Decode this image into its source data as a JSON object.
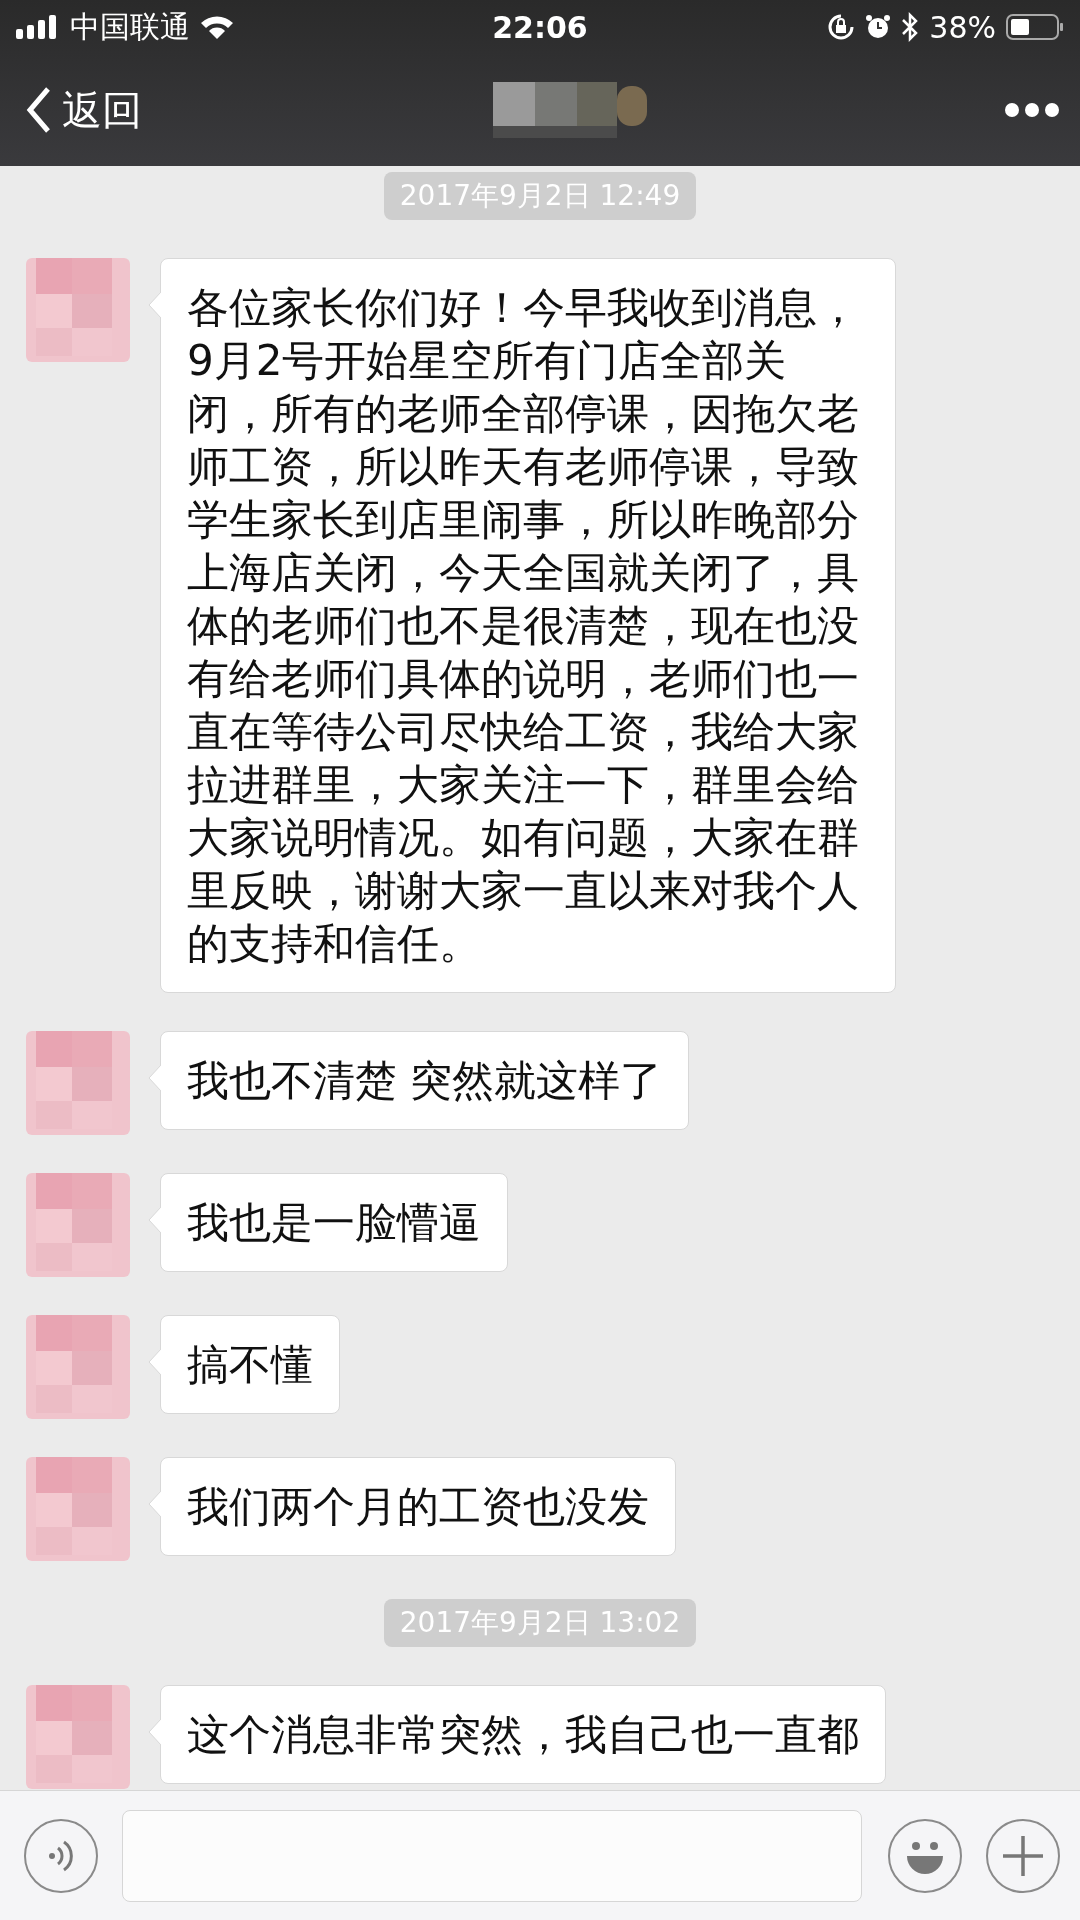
{
  "status_bar": {
    "carrier": "中国联通",
    "time": "22:06",
    "battery": "38%"
  },
  "nav": {
    "back": "返回"
  },
  "messages": [
    {
      "kind": "time",
      "text": "2017年9月2日 12:49"
    },
    {
      "kind": "text",
      "text": "各位家长你们好！今早我收到消息，9月2号开始星空所有门店全部关闭，所有的老师全部停课，因拖欠老师工资，所以昨天有老师停课，导致学生家长到店里闹事，所以昨晚部分上海店关闭，今天全国就关闭了，具体的老师们也不是很清楚，现在也没有给老师们具体的说明，老师们也一直在等待公司尽快给工资，我给大家拉进群里，大家关注一下，群里会给大家说明情况。如有问题，大家在群里反映，谢谢大家一直以来对我个人的支持和信任。"
    },
    {
      "kind": "text",
      "text": "我也不清楚 突然就这样了"
    },
    {
      "kind": "text",
      "text": "我也是一脸懵逼"
    },
    {
      "kind": "text",
      "text": "搞不懂"
    },
    {
      "kind": "text",
      "text": "我们两个月的工资也没发"
    },
    {
      "kind": "time",
      "text": "2017年9月2日 13:02"
    },
    {
      "kind": "text",
      "text": "这个消息非常突然，我自己也一直都"
    }
  ]
}
